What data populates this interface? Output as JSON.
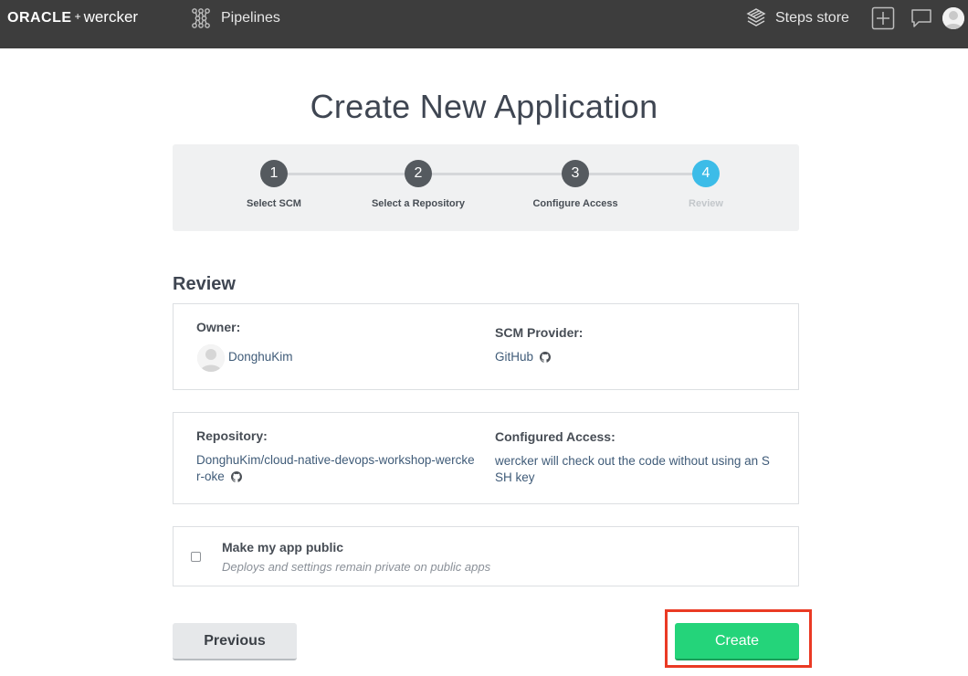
{
  "nav": {
    "brand_oracle": "ORACLE",
    "brand_plus": "+",
    "brand_wercker": "wercker",
    "pipelines_label": "Pipelines",
    "steps_store_label": "Steps store"
  },
  "page": {
    "title": "Create New Application"
  },
  "stepper": {
    "steps": [
      {
        "number": "1",
        "label": "Select SCM",
        "state": "done"
      },
      {
        "number": "2",
        "label": "Select a Repository",
        "state": "done"
      },
      {
        "number": "3",
        "label": "Configure Access",
        "state": "done"
      },
      {
        "number": "4",
        "label": "Review",
        "state": "active"
      }
    ]
  },
  "review": {
    "heading": "Review",
    "owner_label": "Owner:",
    "owner_value": "DonghuKim",
    "scm_label": "SCM Provider:",
    "scm_value": "GitHub",
    "repo_label": "Repository:",
    "repo_value": "DonghuKim/cloud-native-devops-workshop-wercker-oke",
    "access_label": "Configured Access:",
    "access_value": "wercker will check out the code without using an SSH key"
  },
  "public_option": {
    "label": "Make my app public",
    "hint": "Deploys and settings remain private on public apps",
    "checked": false
  },
  "actions": {
    "previous_label": "Previous",
    "create_label": "Create"
  },
  "colors": {
    "topbar": "#3d3d3d",
    "step_active": "#3cbce8",
    "step_done": "#555a5f",
    "create_button": "#24d47a",
    "highlight_frame": "#ea3a24"
  }
}
